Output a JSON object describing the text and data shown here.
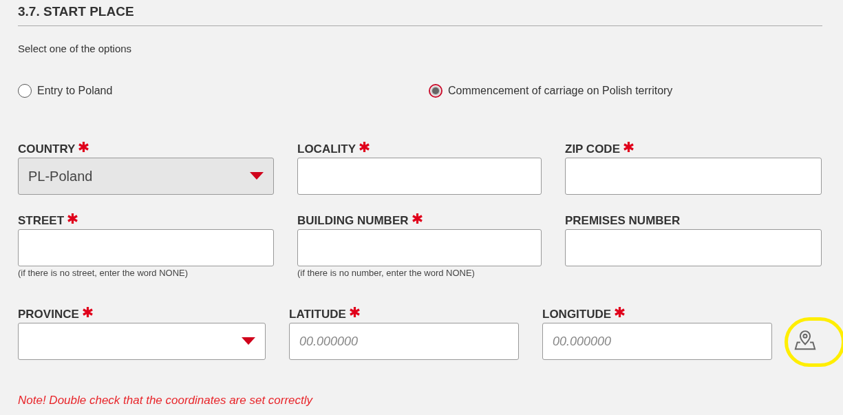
{
  "section": {
    "title": "3.7. START PLACE",
    "instruction": "Select one of the options"
  },
  "options": [
    {
      "label": "Entry to Poland",
      "selected": false
    },
    {
      "label": "Commencement of carriage on Polish territory",
      "selected": true
    }
  ],
  "rows": [
    [
      {
        "kind": "select",
        "label": "COUNTRY",
        "required": true,
        "value": "PL-Poland",
        "disabled": true
      },
      {
        "kind": "text",
        "label": "LOCALITY",
        "required": true
      },
      {
        "kind": "text",
        "label": "ZIP CODE",
        "required": true
      }
    ],
    [
      {
        "kind": "text",
        "label": "STREET",
        "required": true,
        "hint": "(if there is no street, enter the word NONE)"
      },
      {
        "kind": "text",
        "label": "BUILDING NUMBER",
        "required": true,
        "hint": "(if there is no number, enter the word NONE)"
      },
      {
        "kind": "text",
        "label": "PREMISES NUMBER",
        "required": false
      }
    ],
    [
      {
        "kind": "select",
        "label": "PROVINCE",
        "required": true,
        "disabled": false
      },
      {
        "kind": "text",
        "label": "LATITUDE",
        "required": true,
        "placeholder": "00.000000"
      },
      {
        "kind": "text",
        "label": "LONGITUDE",
        "required": true,
        "placeholder": "00.000000"
      }
    ]
  ],
  "map_button": {
    "highlighted": true
  },
  "note": "Note! Double check that the coordinates are set correctly"
}
